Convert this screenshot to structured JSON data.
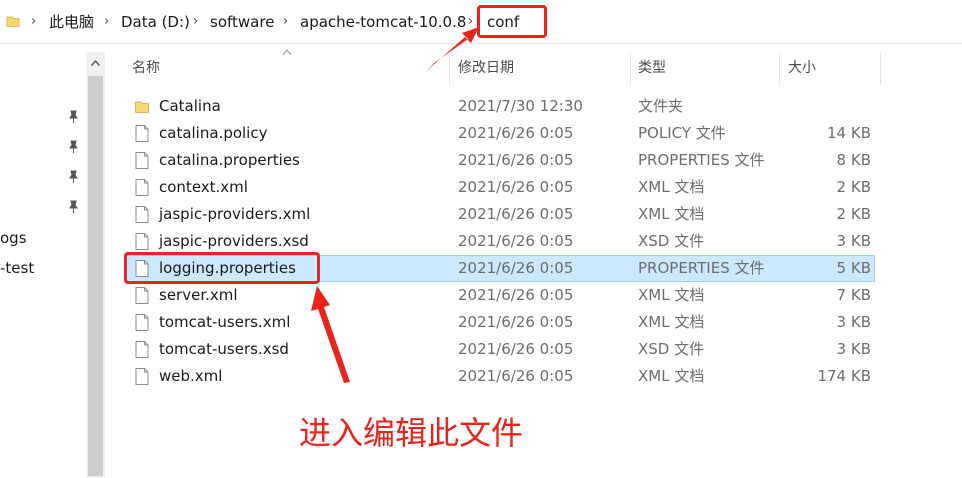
{
  "address": {
    "crumbs": [
      "此电脑",
      "Data (D:)",
      "software",
      "apache-tomcat-10.0.8",
      "conf"
    ]
  },
  "nav": {
    "items": [
      "ogs",
      "-test"
    ]
  },
  "columns": {
    "name": "名称",
    "modified": "修改日期",
    "type": "类型",
    "size": "大小"
  },
  "files": [
    {
      "name": "Catalina",
      "date": "2021/7/30 12:30",
      "type": "文件夹",
      "size": "",
      "icon": "folder-icon"
    },
    {
      "name": "catalina.policy",
      "date": "2021/6/26 0:05",
      "type": "POLICY 文件",
      "size": "14 KB",
      "icon": "file-icon"
    },
    {
      "name": "catalina.properties",
      "date": "2021/6/26 0:05",
      "type": "PROPERTIES 文件",
      "size": "8 KB",
      "icon": "file-icon"
    },
    {
      "name": "context.xml",
      "date": "2021/6/26 0:05",
      "type": "XML 文档",
      "size": "2 KB",
      "icon": "file-icon"
    },
    {
      "name": "jaspic-providers.xml",
      "date": "2021/6/26 0:05",
      "type": "XML 文档",
      "size": "2 KB",
      "icon": "file-icon"
    },
    {
      "name": "jaspic-providers.xsd",
      "date": "2021/6/26 0:05",
      "type": "XSD 文件",
      "size": "3 KB",
      "icon": "file-icon"
    },
    {
      "name": "logging.properties",
      "date": "2021/6/26 0:05",
      "type": "PROPERTIES 文件",
      "size": "5 KB",
      "icon": "file-icon"
    },
    {
      "name": "server.xml",
      "date": "2021/6/26 0:05",
      "type": "XML 文档",
      "size": "7 KB",
      "icon": "file-icon"
    },
    {
      "name": "tomcat-users.xml",
      "date": "2021/6/26 0:05",
      "type": "XML 文档",
      "size": "3 KB",
      "icon": "file-icon"
    },
    {
      "name": "tomcat-users.xsd",
      "date": "2021/6/26 0:05",
      "type": "XSD 文件",
      "size": "3 KB",
      "icon": "file-icon"
    },
    {
      "name": "web.xml",
      "date": "2021/6/26 0:05",
      "type": "XML 文档",
      "size": "174 KB",
      "icon": "file-icon"
    }
  ],
  "annotation": {
    "callout": "进入编辑此文件",
    "color": "#e8241c"
  },
  "colors": {
    "selection": "#cce8ff",
    "selection_border": "#99d1ff",
    "folder": "#f8d775"
  }
}
